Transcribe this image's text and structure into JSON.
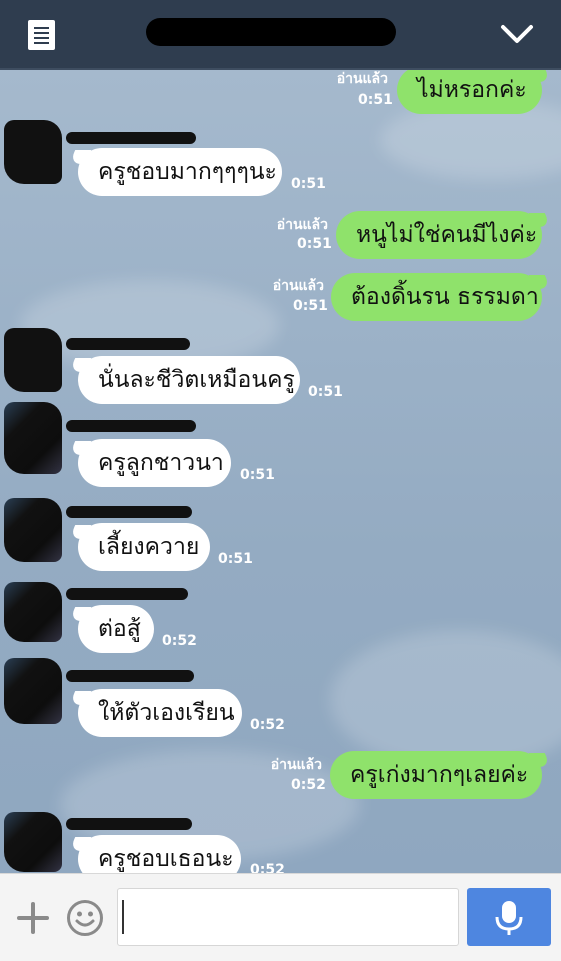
{
  "header": {
    "menu_icon": "list-icon",
    "collapse_icon": "chevron-down-icon"
  },
  "messages": [
    {
      "dir": "out",
      "text": "ไม่หรอกค่ะ",
      "read": "อ่านแล้ว",
      "time": "0:51"
    },
    {
      "dir": "in",
      "text": "ครูชอบมากๆๆๆนะ",
      "time": "0:51"
    },
    {
      "dir": "out",
      "text": "หนูไม่ใช่คนมีไงค่ะ",
      "read": "อ่านแล้ว",
      "time": "0:51"
    },
    {
      "dir": "out",
      "text": "ต้องดิ้นรน ธรรมดา",
      "read": "อ่านแล้ว",
      "time": "0:51"
    },
    {
      "dir": "in",
      "text": "นั่นละชีวิตเหมือนครู",
      "time": "0:51"
    },
    {
      "dir": "in",
      "text": "ครูลูกชาวนา",
      "time": "0:51"
    },
    {
      "dir": "in",
      "text": "เลี้ยงควาย",
      "time": "0:51"
    },
    {
      "dir": "in",
      "text": "ต่อสู้",
      "time": "0:52"
    },
    {
      "dir": "in",
      "text": "ให้ตัวเองเรียน",
      "time": "0:52"
    },
    {
      "dir": "out",
      "text": "ครูเก่งมากๆเลยค่ะ",
      "read": "อ่านแล้ว",
      "time": "0:52"
    },
    {
      "dir": "in",
      "text": "ครูชอบเธอนะ",
      "time": "0:52"
    }
  ],
  "composer": {
    "add_icon": "plus-icon",
    "sticker_icon": "smiley-icon",
    "mic_icon": "microphone-icon",
    "accent": "#4e86e0"
  },
  "colors": {
    "outgoing_bubble": "#8fe26b",
    "incoming_bubble": "#ffffff",
    "header_bg": "#2f3d4f"
  }
}
